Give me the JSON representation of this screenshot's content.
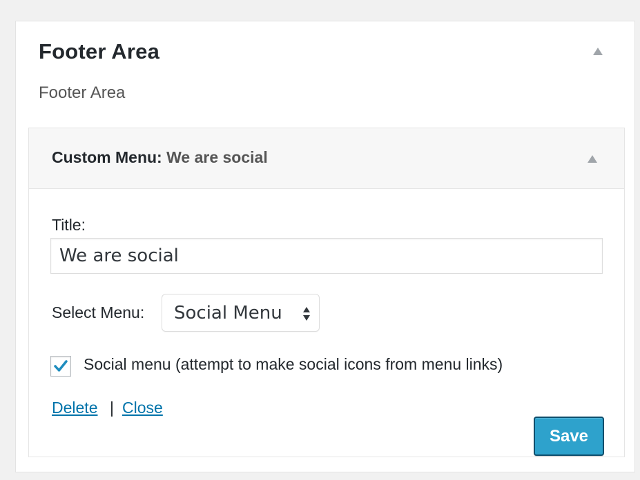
{
  "area": {
    "title": "Footer Area",
    "description": "Footer Area"
  },
  "widget": {
    "type_label": "Custom Menu:",
    "instance_title": "We are social",
    "title_label": "Title:",
    "title_value": "We are social",
    "select_label": "Select Menu:",
    "select_value": "Social Menu",
    "checkbox_checked": true,
    "checkbox_label": "Social menu (attempt to make social icons from menu links)",
    "delete_label": "Delete",
    "separator": "|",
    "close_label": "Close",
    "save_label": "Save"
  },
  "colors": {
    "accent": "#0073aa",
    "save_button": "#2ea2cc",
    "checkmark": "#1e8cbe",
    "background": "#f1f1f1"
  },
  "icons": {
    "area_toggle": "triangle-up-icon",
    "widget_toggle": "triangle-up-icon",
    "select_caret": "up-down-caret-icon",
    "checkmark": "checkmark-icon"
  }
}
